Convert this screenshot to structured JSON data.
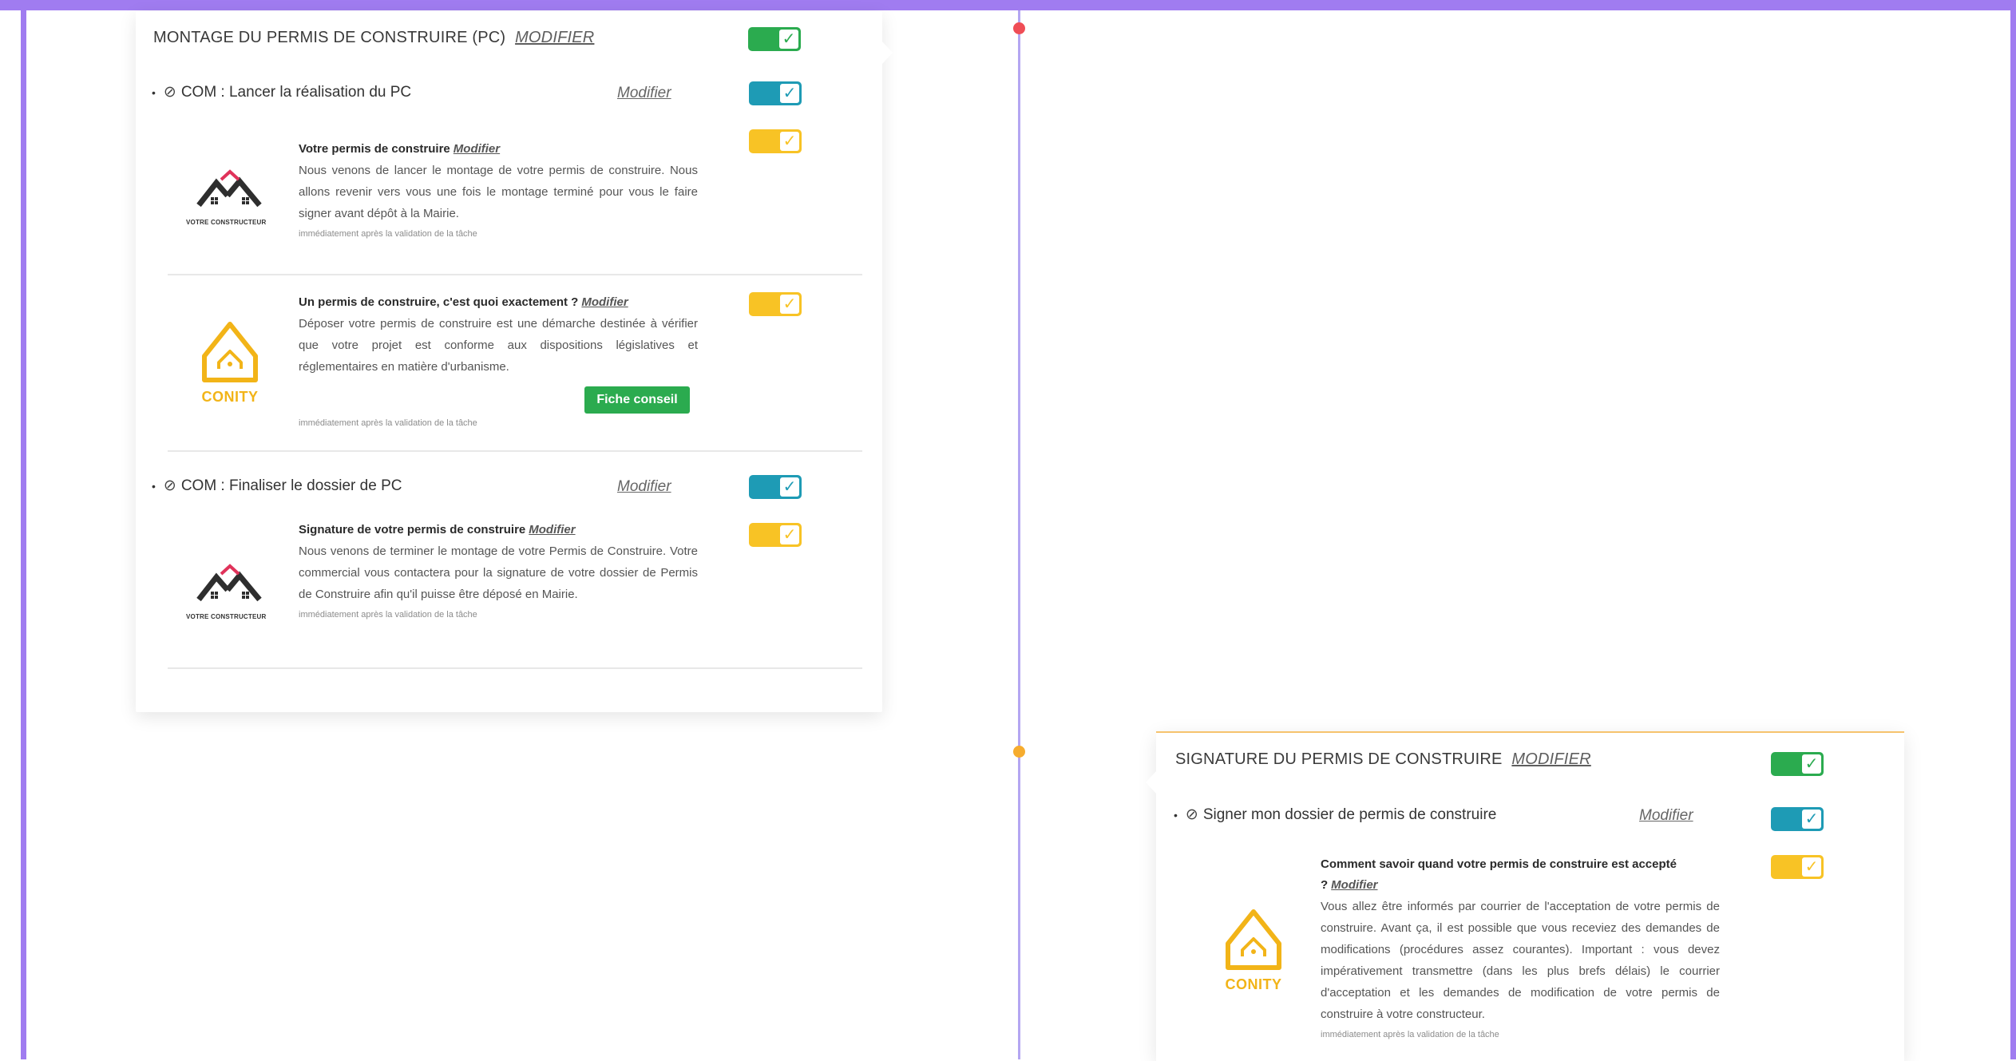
{
  "colors": {
    "frame": "#a07cf0",
    "timeline": "#b4a6f2",
    "dot_red": "#ef4d56",
    "dot_orange": "#f6ac2e",
    "toggle_green": "#2bab4f",
    "toggle_blue": "#1e9bb5",
    "toggle_yellow": "#f8c325",
    "conity_yellow": "#f2b418"
  },
  "card1": {
    "title": "MONTAGE DU PERMIS DE CONSTRUIRE (PC)",
    "modify": "MODIFIER",
    "tasks": [
      {
        "label": "COM : Lancer la réalisation du PC",
        "modify": "Modifier",
        "messages": [
          {
            "logo": "votre-constructeur-logo",
            "logo_text": "VOTRE CONSTRUCTEUR",
            "title": "Votre permis de construire",
            "modify": "Modifier",
            "body": "Nous venons de lancer le montage de votre permis de construire. Nous allons revenir vers vous une fois le montage terminé pour vous le faire signer avant dépôt à la Mairie.",
            "timing": "immédiatement après la validation de la tâche"
          },
          {
            "logo": "conity-logo",
            "logo_text": "CONITY",
            "title": "Un permis de construire, c'est quoi exactement ?",
            "modify": "Modifier",
            "body": "Déposer votre permis de construire est une démarche destinée à vérifier que votre projet est conforme aux dispositions législatives et réglementaires en matière d'urbanisme.",
            "button": "Fiche conseil",
            "timing": "immédiatement après la validation de la tâche"
          }
        ]
      },
      {
        "label": "COM : Finaliser le dossier de PC",
        "modify": "Modifier",
        "messages": [
          {
            "logo": "votre-constructeur-logo",
            "logo_text": "VOTRE CONSTRUCTEUR",
            "title": "Signature de votre permis de construire",
            "modify": "Modifier",
            "body": "Nous venons de terminer le montage de votre Permis de Construire. Votre commercial vous contactera pour la signature de votre dossier de Permis de Construire afin qu'il puisse être déposé en Mairie.",
            "timing": "immédiatement après la validation de la tâche"
          }
        ]
      }
    ]
  },
  "card2": {
    "title": "SIGNATURE DU PERMIS DE CONSTRUIRE",
    "modify": "MODIFIER",
    "tasks": [
      {
        "label": "Signer mon dossier de permis de construire",
        "modify": "Modifier",
        "messages": [
          {
            "logo": "conity-logo",
            "logo_text": "CONITY",
            "title_line1": "Comment savoir quand votre permis de construire est accepté",
            "title_line2": "?",
            "modify": "Modifier",
            "body": "Vous allez être informés par courrier de l'acceptation de votre permis de construire. Avant ça, il est possible que vous receviez des demandes de modifications (procédures assez courantes). Important : vous devez impérativement transmettre (dans les plus brefs délais) le courrier d'acceptation et les demandes de modification de votre permis de construire à votre constructeur.",
            "timing": "immédiatement après la validation de la tâche"
          }
        ]
      }
    ]
  },
  "toggle_check": "✓",
  "task_check": "⊘",
  "bullet": "•"
}
